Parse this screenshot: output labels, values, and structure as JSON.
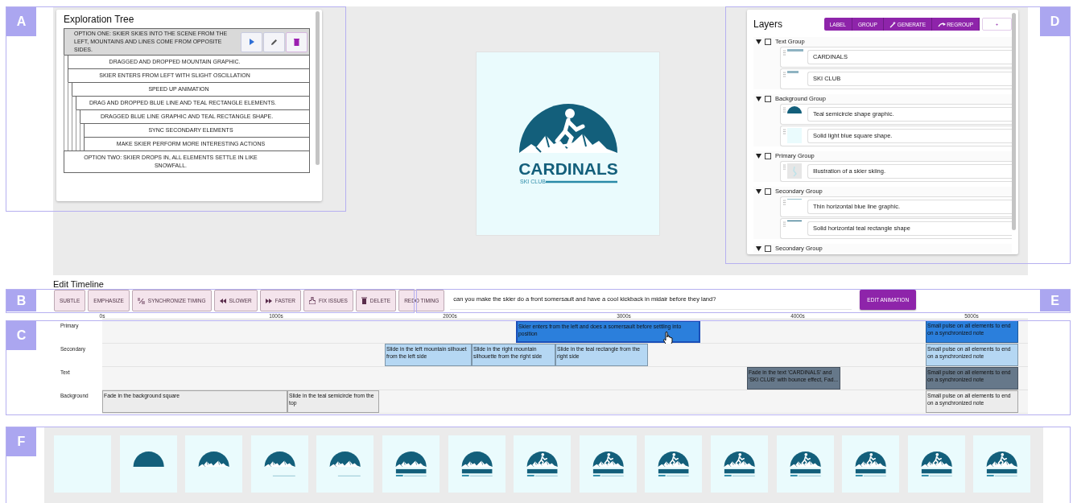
{
  "annotations": [
    {
      "letter": "A"
    },
    {
      "letter": "D"
    },
    {
      "letter": "B"
    },
    {
      "letter": "E"
    },
    {
      "letter": "C"
    },
    {
      "letter": "F"
    }
  ],
  "exploration_tree": {
    "title": "Exploration Tree",
    "nodes": [
      {
        "label": "OPTION ONE: SKIER SKIES INTO THE SCENE FROM THE LEFT, MOUNTAINS AND LINES COME FROM OPPOSITE SIDES.",
        "selected": true,
        "children": [
          {
            "label": "DRAGGED AND DROPPED MOUNTAIN GRAPHIC.",
            "selected": false
          },
          {
            "label": "SKIER ENTERS FROM LEFT WITH SLIGHT OSCILLATION",
            "selected": false,
            "children": [
              {
                "label": "SPEED UP ANIMATION",
                "selected": false,
                "children": [
                  {
                    "label": "DRAG AND DROPPED BLUE LINE AND TEAL RECTANGLE ELEMENTS.",
                    "selected": false,
                    "children": [
                      {
                        "label": "DRAGGED BLUE LINE GRAPHIC AND TEAL RECTANGLE SHAPE.",
                        "selected": false,
                        "children": [
                          {
                            "label": "SYNC SECONDARY ELEMENTS",
                            "selected": false
                          },
                          {
                            "label": "MAKE SKIER PERFORM MORE INTERESTING ACTIONS",
                            "selected": false
                          }
                        ]
                      }
                    ]
                  }
                ]
              }
            ]
          }
        ]
      },
      {
        "label": "OPTION TWO: SKIER DROPS IN, ALL ELEMENTS SETTLE IN LIKE SNOWFALL.",
        "selected": false
      }
    ]
  },
  "canvas": {
    "title": "CARDINALS",
    "subtitle": "SKI CLUB"
  },
  "layers": {
    "title": "Layers",
    "actions": [
      {
        "label": "LABEL",
        "kind": "plain"
      },
      {
        "label": "GROUP",
        "kind": "plain"
      },
      {
        "label": "GENERATE",
        "kind": "generate"
      },
      {
        "label": "REGROUP",
        "kind": "regroup"
      },
      {
        "label": "+",
        "kind": "add"
      }
    ],
    "groups": [
      {
        "name": "Text Group",
        "expanded": true,
        "checked": false,
        "items": [
          {
            "kind": "wordmark",
            "value": "CARDINALS"
          },
          {
            "kind": "subtitle",
            "value": "SKI CLUB"
          }
        ]
      },
      {
        "name": "Background Group",
        "expanded": true,
        "checked": false,
        "items": [
          {
            "kind": "semicircle",
            "value": "Teal semicircle shape graphic."
          },
          {
            "kind": "square",
            "value": "Solid light blue square shape."
          }
        ]
      },
      {
        "name": "Primary Group",
        "expanded": true,
        "checked": false,
        "items": [
          {
            "kind": "skier",
            "value": "Illustration of a skier skiing."
          }
        ]
      },
      {
        "name": "Secondary Group",
        "expanded": true,
        "checked": false,
        "items": [
          {
            "kind": "line",
            "value": "Thin horizontal blue line graphic."
          },
          {
            "kind": "bar",
            "value": "Solid horizontal teal rectangle shape"
          }
        ]
      },
      {
        "name": "Secondary Group",
        "expanded": true,
        "checked": false
      }
    ]
  },
  "timeline": {
    "title": "Edit Timeline",
    "actions": [
      {
        "label": "SUBTLE",
        "kind": "plain"
      },
      {
        "label": "EMPHASIZE",
        "kind": "plain"
      },
      {
        "label": "SYNCHRONIZE TIMING",
        "kind": "sync"
      },
      {
        "label": "SLOWER",
        "kind": "slower"
      },
      {
        "label": "FASTER",
        "kind": "faster"
      },
      {
        "label": "FIX ISSUES",
        "kind": "fix"
      },
      {
        "label": "DELETE",
        "kind": "delete"
      },
      {
        "label": "REDO TIMING",
        "kind": "plain"
      }
    ],
    "prompt": {
      "value": "can you make the skier do a front somersault and have a cool kickback in midair before they land?",
      "button": "EDIT ANIMATION"
    },
    "ticks": [
      "0s",
      "1000s",
      "2000s",
      "3000s",
      "4000s",
      "5000s"
    ],
    "rows": [
      {
        "name": "Primary",
        "color": "#2b7fdc",
        "clips": [
          {
            "text": "Skier enters from the left and does a somersault before settling into position",
            "selected": true
          },
          {
            "text": "Small pulse on all elements to end on a synchronized note",
            "selected": false
          }
        ]
      },
      {
        "name": "Secondary",
        "color": "#b5d7f3",
        "clips": [
          {
            "text": "Slide in the left mountain silhouet from the left side",
            "selected": false
          },
          {
            "text": "Slide in the right mountain silhouette from the right side",
            "selected": false
          },
          {
            "text": "Slide in the teal rectangle from the right side",
            "selected": false
          },
          {
            "text": "Small pulse on all elements to end on a synchronized note",
            "selected": false
          }
        ]
      },
      {
        "name": "Text",
        "color": "#66788a",
        "clips": [
          {
            "text": "Fade in the text 'CARDINALS' and 'SKI CLUB' with bounce effect, Fad...",
            "selected": false
          },
          {
            "text": "Small pulse on all elements to end on a synchronized note",
            "selected": false
          }
        ]
      },
      {
        "name": "Background",
        "color": "#ececec",
        "clips": [
          {
            "text": "Fade in the background square",
            "selected": false
          },
          {
            "text": "Slide in the teal semicircle from the top",
            "selected": false
          },
          {
            "text": "Small pulse on all elements to end on a synchronized note",
            "selected": false
          }
        ]
      }
    ]
  },
  "frames": [
    {
      "semicircle": false,
      "mountains": false,
      "line": false,
      "wordmark": false,
      "skier": false
    },
    {
      "semicircle": true,
      "mountains": false,
      "line": false,
      "wordmark": false,
      "skier": false
    },
    {
      "semicircle": true,
      "mountains": true,
      "line": false,
      "wordmark": false,
      "skier": false
    },
    {
      "semicircle": true,
      "mountains": true,
      "line": true,
      "wordmark": false,
      "skier": false
    },
    {
      "semicircle": true,
      "mountains": true,
      "line": true,
      "wordmark": false,
      "skier": false
    },
    {
      "semicircle": true,
      "mountains": true,
      "line": true,
      "wordmark": true,
      "skier": false
    },
    {
      "semicircle": true,
      "mountains": true,
      "line": true,
      "wordmark": true,
      "skier": false
    },
    {
      "semicircle": true,
      "mountains": true,
      "line": true,
      "wordmark": true,
      "skier": true
    },
    {
      "semicircle": true,
      "mountains": true,
      "line": true,
      "wordmark": true,
      "skier": true
    },
    {
      "semicircle": true,
      "mountains": true,
      "line": true,
      "wordmark": true,
      "skier": true
    },
    {
      "semicircle": true,
      "mountains": true,
      "line": true,
      "wordmark": true,
      "skier": true
    },
    {
      "semicircle": true,
      "mountains": true,
      "line": true,
      "wordmark": true,
      "skier": true
    },
    {
      "semicircle": true,
      "mountains": true,
      "line": true,
      "wordmark": true,
      "skier": true
    },
    {
      "semicircle": true,
      "mountains": true,
      "line": true,
      "wordmark": true,
      "skier": true
    },
    {
      "semicircle": true,
      "mountains": true,
      "line": true,
      "wordmark": true,
      "skier": true
    }
  ]
}
